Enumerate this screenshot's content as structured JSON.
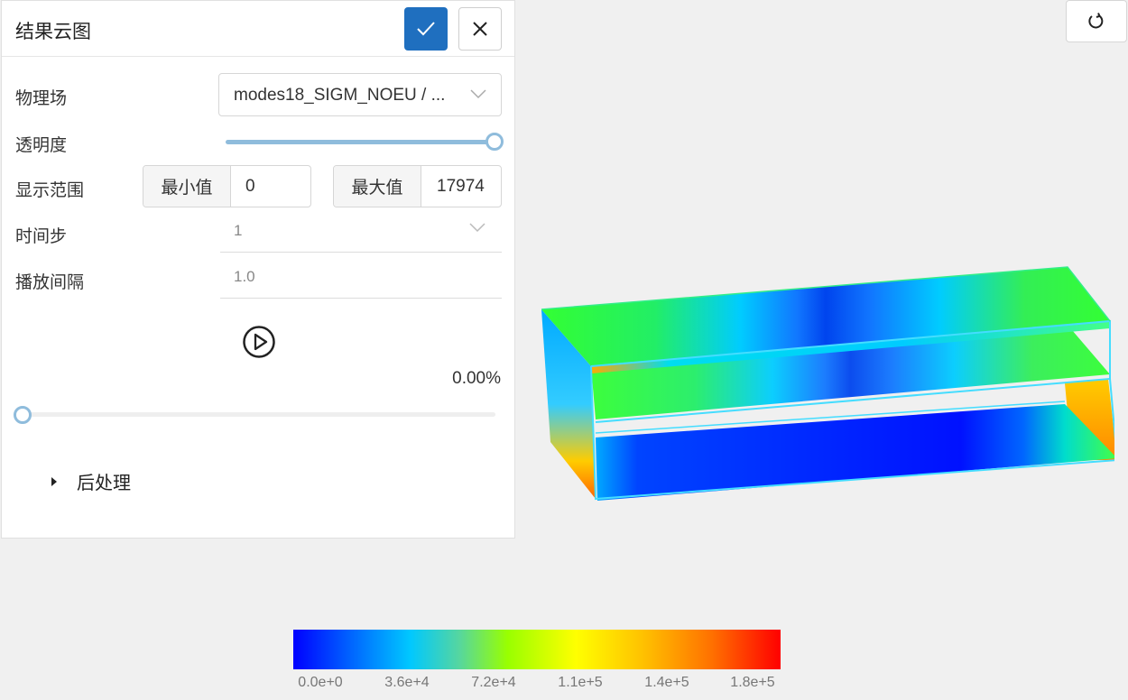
{
  "panel": {
    "title": "结果云图",
    "field_label": "物理场",
    "field_value": "modes18_SIGM_NOEU / ...",
    "opacity_label": "透明度",
    "opacity_value": 1.0,
    "range_label": "显示范围",
    "min_label": "最小值",
    "min_value": "0",
    "max_label": "最大值",
    "max_value": "17974",
    "timestep_label": "时间步",
    "timestep_value": "1",
    "interval_label": "播放间隔",
    "interval_value": "1.0",
    "progress_text": "0.00%",
    "progress_value": 0.0,
    "postprocess_label": "后处理"
  },
  "icons": {
    "confirm": "check-icon",
    "close": "close-icon",
    "dropdown": "chevron-down-icon",
    "play": "play-circle-icon",
    "reset": "rotate-icon",
    "expand": "caret-right-icon"
  },
  "colors": {
    "accent": "#1f6fbf",
    "slider": "#8fbcdc"
  },
  "legend": {
    "ticks": [
      "0.0e+0",
      "3.6e+4",
      "7.2e+4",
      "1.1e+5",
      "1.4e+5",
      "1.8e+5"
    ]
  }
}
